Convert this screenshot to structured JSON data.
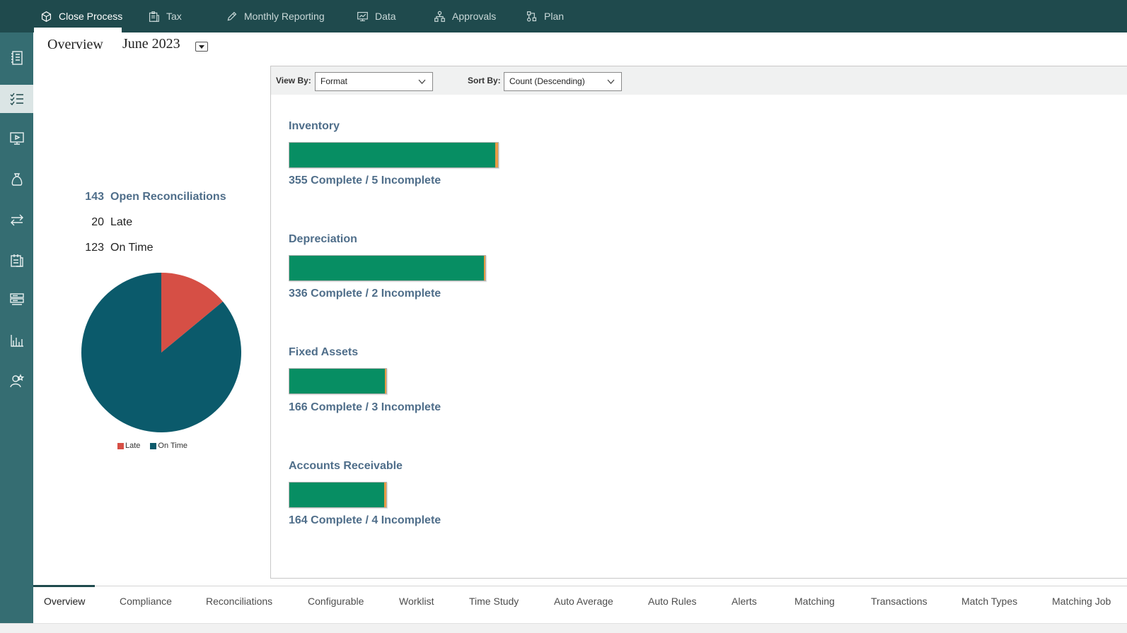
{
  "topnav": {
    "items": [
      {
        "label": "Close Process",
        "icon": "cube-icon",
        "active": true
      },
      {
        "label": "Tax",
        "icon": "clipboard-icon",
        "active": false
      },
      {
        "label": "Monthly Reporting",
        "icon": "pencil-icon",
        "active": false
      },
      {
        "label": "Data",
        "icon": "monitor-icon",
        "active": false
      },
      {
        "label": "Approvals",
        "icon": "hierarchy-icon",
        "active": false
      },
      {
        "label": "Plan",
        "icon": "workflow-icon",
        "active": false
      }
    ]
  },
  "sidebar": {
    "icons": [
      "ledger-icon",
      "checklist-icon",
      "presentation-icon",
      "money-bag-icon",
      "transfer-icon",
      "calendar-clipboard-icon",
      "server-icon",
      "bar-chart-icon",
      "user-star-icon"
    ],
    "active_index": 1
  },
  "header": {
    "title": "Overview",
    "period": "June 2023"
  },
  "summary": {
    "open": {
      "count": "143",
      "label": "Open Reconciliations"
    },
    "late": {
      "count": "20",
      "label": "Late"
    },
    "on_time": {
      "count": "123",
      "label": "On Time"
    }
  },
  "colors": {
    "late": "#d64f45",
    "on_time": "#0b5a6b",
    "complete": "#078e63",
    "incomplete": "#e99b45",
    "nav_bg": "#1f4a4d",
    "sidebar_bg": "#356d72",
    "link": "#4f6e8a"
  },
  "chart_data": {
    "type": "pie",
    "slices": [
      {
        "label": "Late",
        "value": 20
      },
      {
        "label": "On Time",
        "value": 123
      }
    ],
    "legend": [
      "Late",
      "On Time"
    ],
    "legend_position": "bottom"
  },
  "toolbar": {
    "view_by_label": "View By:",
    "view_by_value": "Format",
    "sort_by_label": "Sort By:",
    "sort_by_value": "Count (Descending)"
  },
  "categories": [
    {
      "name": "Inventory",
      "complete": 355,
      "incomplete": 5,
      "text": "355 Complete / 5 Incomplete"
    },
    {
      "name": "Depreciation",
      "complete": 336,
      "incomplete": 2,
      "text": "336 Complete / 2 Incomplete"
    },
    {
      "name": "Fixed Assets",
      "complete": 166,
      "incomplete": 3,
      "text": "166 Complete / 3 Incomplete"
    },
    {
      "name": "Accounts Receivable",
      "complete": 164,
      "incomplete": 4,
      "text": "164 Complete / 4 Incomplete"
    }
  ],
  "tabs": [
    "Overview",
    "Compliance",
    "Reconciliations",
    "Configurable",
    "Worklist",
    "Time Study",
    "Auto Average",
    "Auto Rules",
    "Alerts",
    "Matching",
    "Transactions",
    "Match Types",
    "Matching Job"
  ],
  "active_tab": 0
}
